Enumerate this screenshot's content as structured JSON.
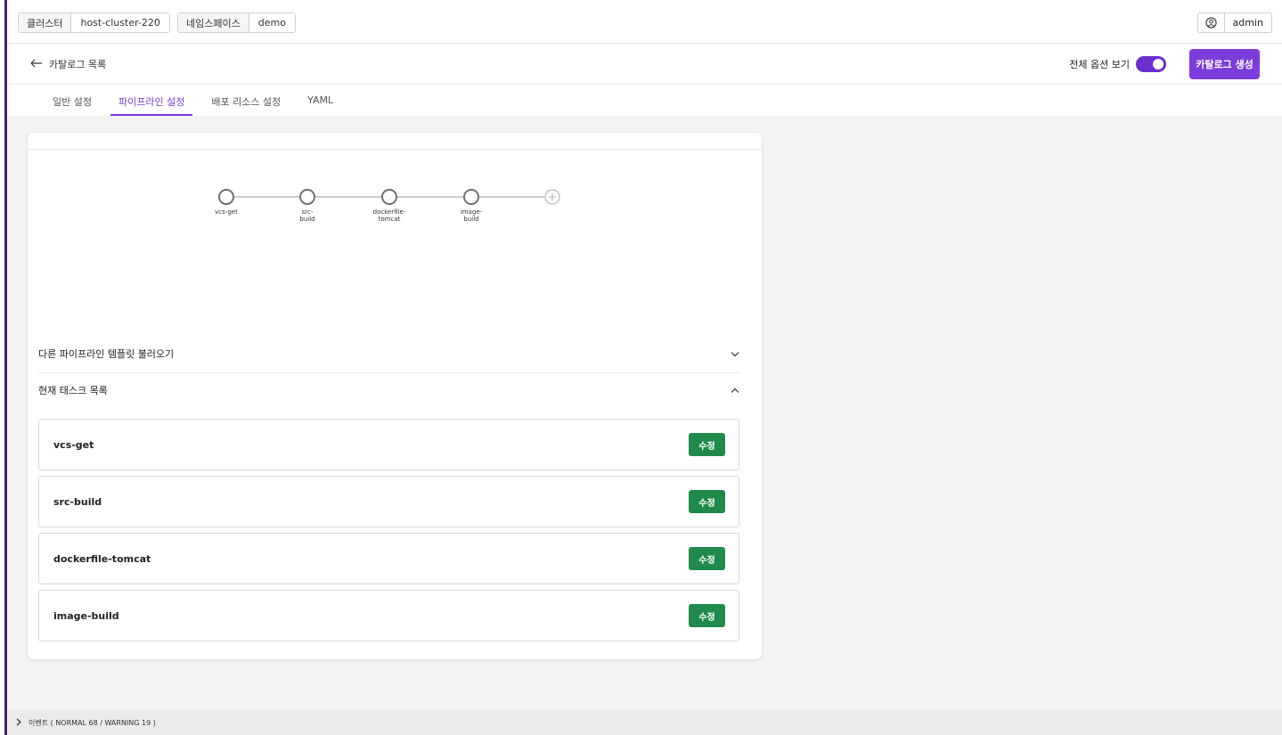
{
  "topbar": {
    "cluster_label": "클러스터",
    "cluster_value": "host-cluster-220",
    "namespace_label": "네임스페이스",
    "namespace_value": "demo",
    "user_name": "admin"
  },
  "subheader": {
    "back_label": "카탈로그 목록",
    "toggle_label": "전체 옵션 보기",
    "toggle_on": true,
    "create_button": "카탈로그 생성"
  },
  "tabs": [
    {
      "label": "일반 설정",
      "active": false
    },
    {
      "label": "파이프라인 설정",
      "active": true
    },
    {
      "label": "배포 리소스 설정",
      "active": false
    },
    {
      "label": "YAML",
      "active": false
    }
  ],
  "pipeline": {
    "nodes": [
      {
        "line1": "vcs-get",
        "line2": ""
      },
      {
        "line1": "src-",
        "line2": "build"
      },
      {
        "line1": "dockerfile-",
        "line2": "tomcat"
      },
      {
        "line1": "image-",
        "line2": "build"
      }
    ]
  },
  "accordion": {
    "template_label": "다른 파이프라인 템플릿 불러오기",
    "tasks_label": "현재 태스크 목록"
  },
  "tasks": [
    {
      "name": "vcs-get",
      "edit_label": "수정"
    },
    {
      "name": "src-build",
      "edit_label": "수정"
    },
    {
      "name": "dockerfile-tomcat",
      "edit_label": "수정"
    },
    {
      "name": "image-build",
      "edit_label": "수정"
    }
  ],
  "footer": {
    "events_label": "이벤트 ( NORMAL 68 / WARNING 19 )"
  },
  "colors": {
    "accent": "#7c3cdc",
    "edit_button": "#1f8a4c"
  }
}
